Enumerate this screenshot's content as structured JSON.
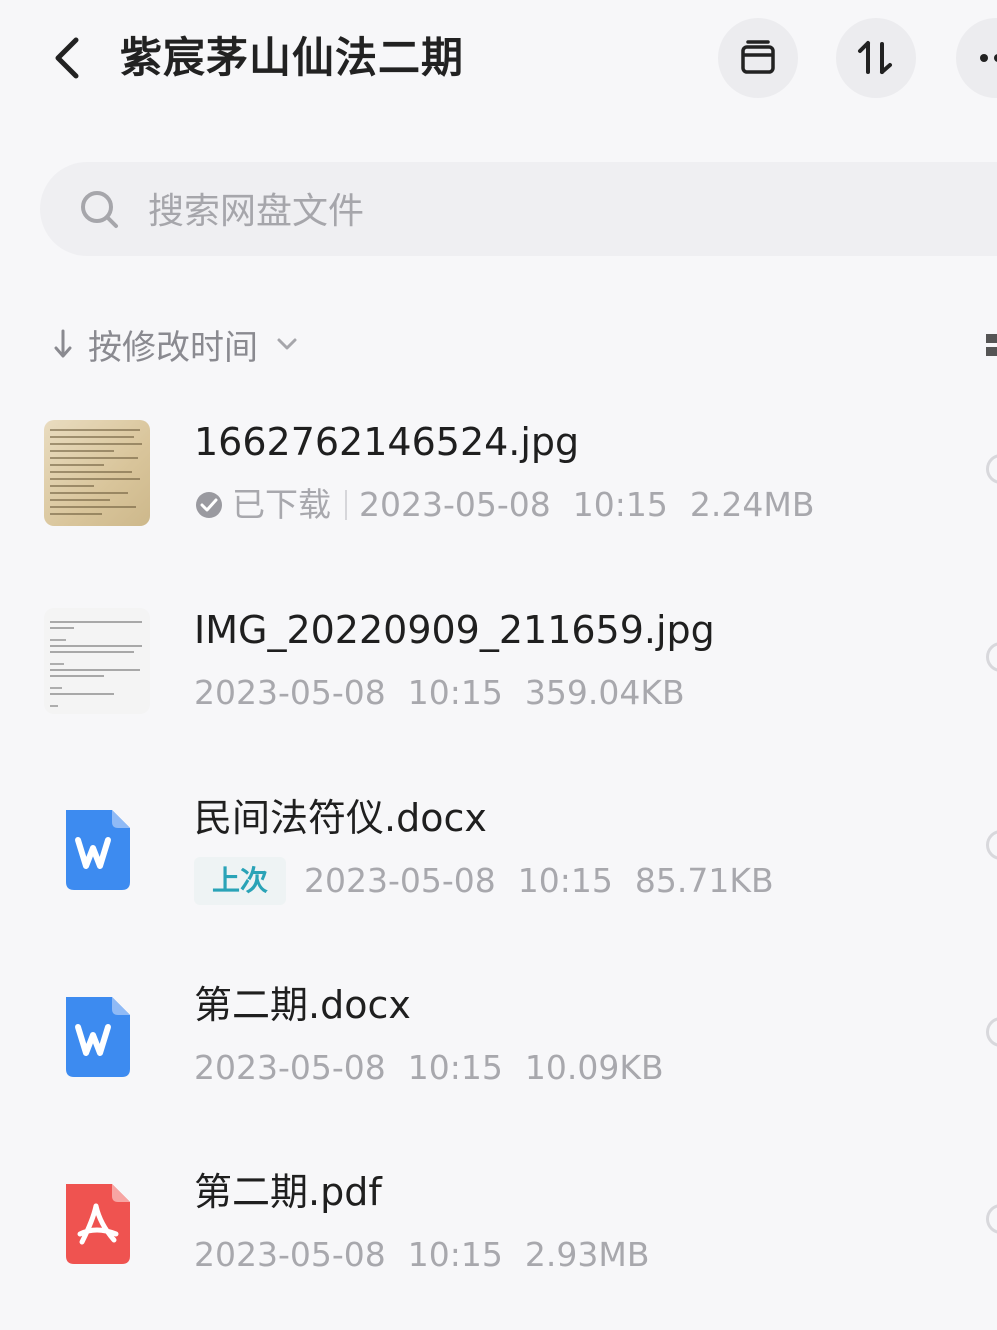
{
  "header": {
    "back_icon": "chevron-left-icon",
    "title": "紫宸茅山仙法二期",
    "actions": [
      {
        "icon": "archive-icon"
      },
      {
        "icon": "sort-updown-icon"
      },
      {
        "icon": "more-icon"
      }
    ]
  },
  "search": {
    "placeholder": "搜索网盘文件",
    "icon": "search-icon"
  },
  "sort": {
    "label": "按修改时间",
    "direction_icon": "arrow-down-icon",
    "dropdown_icon": "chevron-down-icon"
  },
  "files": [
    {
      "name": "1662762146524.jpg",
      "status": "已下载",
      "date": "2023-05-08",
      "time": "10:15",
      "size": "2.24MB",
      "icon": "image-thumbnail"
    },
    {
      "name": "IMG_20220909_211659.jpg",
      "date": "2023-05-08",
      "time": "10:15",
      "size": "359.04KB",
      "icon": "image-thumbnail"
    },
    {
      "name": "民间法符仪.docx",
      "tag": "上次",
      "date": "2023-05-08",
      "time": "10:15",
      "size": "85.71KB",
      "icon": "word-doc-icon"
    },
    {
      "name": "第二期.docx",
      "date": "2023-05-08",
      "time": "10:15",
      "size": "10.09KB",
      "icon": "word-doc-icon"
    },
    {
      "name": "第二期.pdf",
      "date": "2023-05-08",
      "time": "10:15",
      "size": "2.93MB",
      "icon": "pdf-icon"
    }
  ],
  "colors": {
    "background": "#f7f7f9",
    "word_blue": "#3d8bf0",
    "pdf_red": "#ef5350",
    "tag_teal": "#2aa3b7",
    "downloaded_check": "#9a9aa0"
  }
}
